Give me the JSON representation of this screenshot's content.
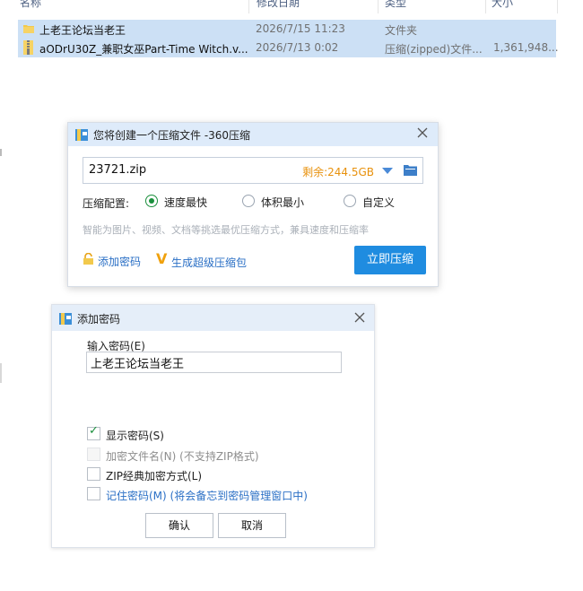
{
  "columns": [
    "名称",
    "修改日期",
    "类型",
    "大小"
  ],
  "files": [
    {
      "name": "上老王论坛当老王",
      "date": "2026/7/15 11:23",
      "type": "文件夹",
      "size": "",
      "icon": "folder-icon"
    },
    {
      "name": "aODrU30Z_兼职女巫Part-Time Witch.v...",
      "date": "2026/7/13 0:02",
      "type": "压缩(zipped)文件...",
      "size": "1,361,948...",
      "icon": "zip-file-icon"
    }
  ],
  "compress_dialog": {
    "title": "您将创建一个压缩文件 -360压缩",
    "path": "23721.zip",
    "free_space": "剩余:244.5GB",
    "config_label": "压缩配置:",
    "options": [
      {
        "label": "速度最快",
        "selected": true
      },
      {
        "label": "体积最小",
        "selected": false
      },
      {
        "label": "自定义",
        "selected": false
      }
    ],
    "hint": "智能为图片、视频、文档等挑选最优压缩方式，兼具速度和压缩率",
    "add_password_label": "添加密码",
    "sfx_label": "生成超级压缩包",
    "compress_button": "立即压缩",
    "accent_color": "#1f8ce0"
  },
  "password_dialog": {
    "title": "添加密码",
    "input_label": "输入密码(E)",
    "password_value": "上老王论坛当老王",
    "checkboxes": [
      {
        "label": "显示密码(S)",
        "checked": true,
        "enabled": true
      },
      {
        "label": "加密文件名(N) (不支持ZIP格式)",
        "checked": false,
        "enabled": false
      },
      {
        "label": "ZIP经典加密方式(L)",
        "checked": false,
        "enabled": true
      },
      {
        "label": "记住密码(M) (将会备忘到密码管理窗口中)",
        "checked": false,
        "enabled": true
      }
    ],
    "ok_button": "确认",
    "cancel_button": "取消"
  }
}
